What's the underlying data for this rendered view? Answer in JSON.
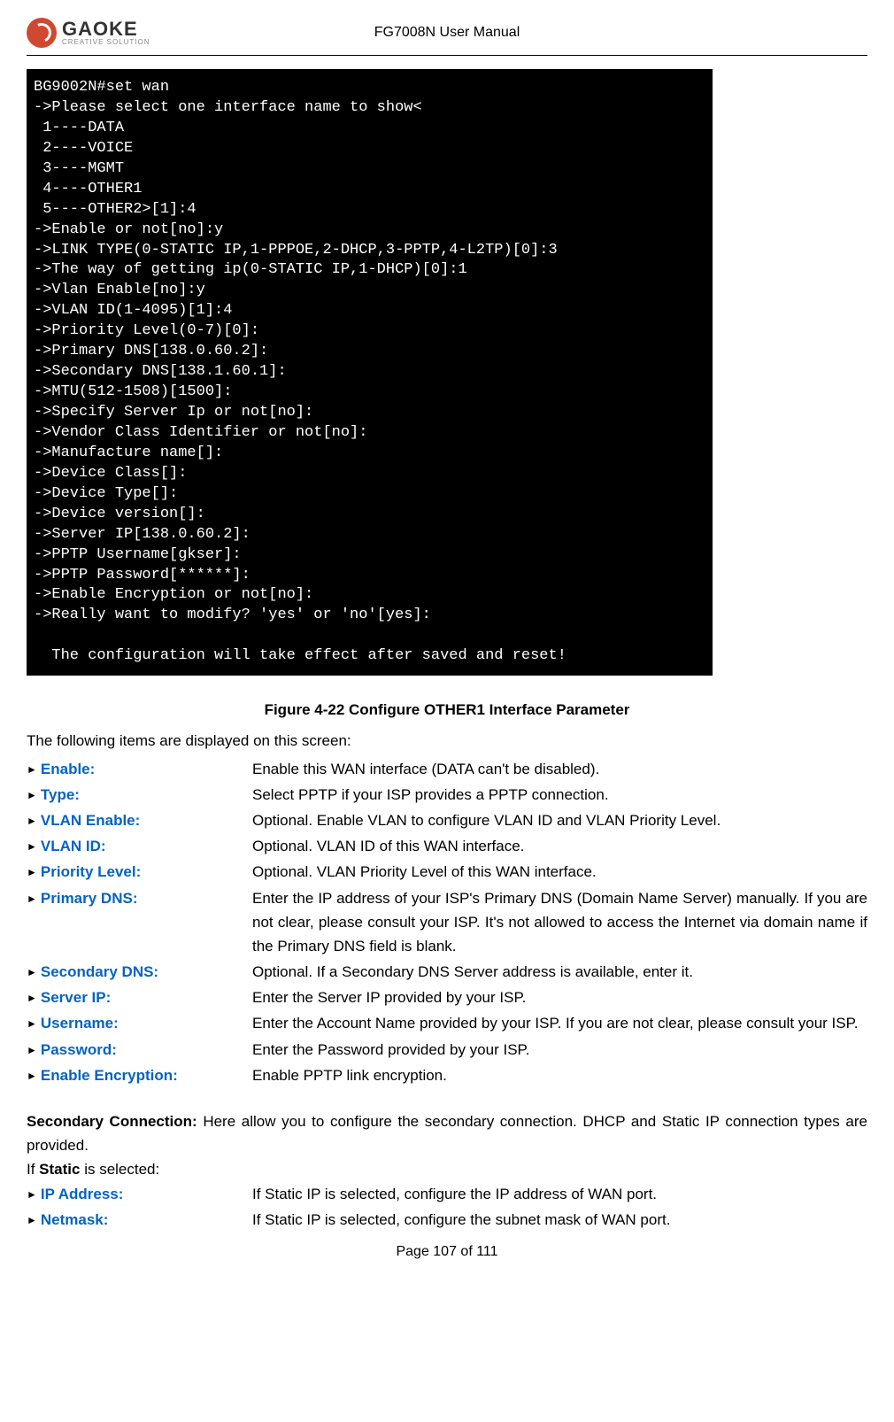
{
  "header": {
    "logo_name": "GAOKE",
    "logo_tagline": "CREATIVE SOLUTION",
    "doc_title": "FG7008N User Manual"
  },
  "terminal": {
    "lines": [
      "BG9002N#set wan",
      "->Please select one interface name to show<",
      " 1----DATA",
      " 2----VOICE",
      " 3----MGMT",
      " 4----OTHER1",
      " 5----OTHER2>[1]:4",
      "->Enable or not[no]:y",
      "->LINK TYPE(0-STATIC IP,1-PPPOE,2-DHCP,3-PPTP,4-L2TP)[0]:3",
      "->The way of getting ip(0-STATIC IP,1-DHCP)[0]:1",
      "->Vlan Enable[no]:y",
      "->VLAN ID(1-4095)[1]:4",
      "->Priority Level(0-7)[0]:",
      "->Primary DNS[138.0.60.2]:",
      "->Secondary DNS[138.1.60.1]:",
      "->MTU(512-1508)[1500]:",
      "->Specify Server Ip or not[no]:",
      "->Vendor Class Identifier or not[no]:",
      "->Manufacture name[]:",
      "->Device Class[]:",
      "->Device Type[]:",
      "->Device version[]:",
      "->Server IP[138.0.60.2]:",
      "->PPTP Username[gkser]:",
      "->PPTP Password[******]:",
      "->Enable Encryption or not[no]:",
      "->Really want to modify? 'yes' or 'no'[yes]:",
      "",
      "  The configuration will take effect after saved and reset!",
      ""
    ]
  },
  "figure_caption": "Figure 4-22  Configure OTHER1 Interface Parameter",
  "intro": "The following items are displayed on this screen:",
  "params": [
    {
      "label": "Enable:",
      "desc": "Enable this WAN interface (DATA can't be disabled)."
    },
    {
      "label": "Type:",
      "desc": "Select PPTP if your ISP provides a PPTP connection."
    },
    {
      "label": "VLAN Enable:",
      "desc": "Optional. Enable VLAN to configure VLAN ID and VLAN Priority Level."
    },
    {
      "label": "VLAN ID:",
      "desc": "Optional. VLAN ID of this WAN interface."
    },
    {
      "label": "Priority Level:",
      "desc": "Optional. VLAN Priority Level of this WAN interface."
    },
    {
      "label": "Primary DNS:",
      "desc": "Enter the IP address of your ISP's Primary DNS (Domain Name Server) manually. If you are not clear, please consult your ISP. It's not allowed to access the Internet via domain name if the Primary DNS field is blank."
    },
    {
      "label": "Secondary DNS:",
      "desc": "Optional. If a Secondary DNS Server address is available, enter it."
    },
    {
      "label": "Server IP:",
      "desc": "Enter the Server IP provided by your ISP."
    },
    {
      "label": "Username:",
      "desc": "Enter the Account Name provided by your ISP. If you are not clear, please consult your ISP."
    },
    {
      "label": "Password:",
      "desc": "Enter the Password provided by your ISP."
    },
    {
      "label": "Enable Encryption:",
      "desc": "Enable PPTP link encryption."
    }
  ],
  "secondary_section": {
    "heading_prefix": "Secondary Connection:",
    "text": " Here allow you to configure the secondary connection. DHCP and Static IP connection types are provided.",
    "static_intro_prefix": "If ",
    "static_intro_bold": "Static",
    "static_intro_suffix": " is selected:"
  },
  "static_params": [
    {
      "label": "IP Address:",
      "desc": "If Static IP is selected, configure the IP address of WAN port."
    },
    {
      "label": "Netmask:",
      "desc": "If Static IP is selected, configure the subnet mask of WAN port."
    }
  ],
  "footer": "Page 107 of 111"
}
